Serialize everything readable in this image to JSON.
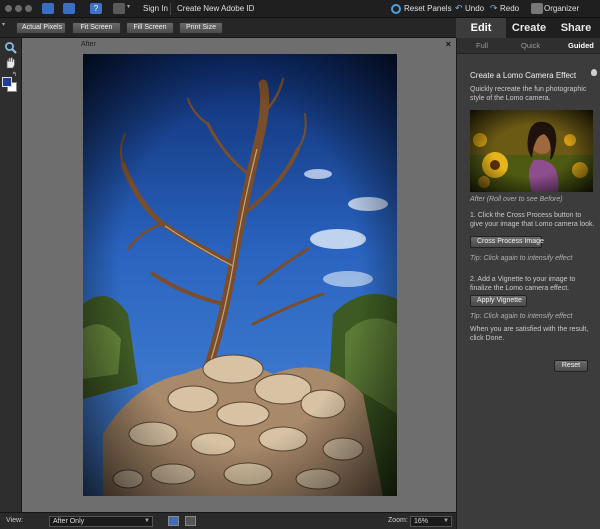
{
  "topbar": {
    "sign_in": "Sign In",
    "create_id": "Create New Adobe ID",
    "reset_panels": "Reset Panels",
    "undo": "Undo",
    "redo": "Redo",
    "organizer": "Organizer"
  },
  "mode_tabs": {
    "edit": "Edit",
    "create": "Create",
    "share": "Share"
  },
  "toolbar": {
    "actual_pixels": "Actual Pixels",
    "fit_screen": "Fit Screen",
    "fill_screen": "Fill Screen",
    "print_size": "Print Size"
  },
  "document": {
    "title": "After",
    "close": "×"
  },
  "status": {
    "view_label": "View:",
    "view_value": "After Only",
    "zoom_label": "Zoom:",
    "zoom_value": "16%"
  },
  "panel": {
    "subtabs": {
      "full": "Full",
      "quick": "Quick",
      "guided": "Guided"
    },
    "title": "Create a Lomo Camera Effect",
    "intro": "Quickly recreate the fun photographic style of the Lomo camera.",
    "caption": "After (Roll over to see Before)",
    "step1": "1. Click the Cross Process button to give your image that Lomo camera look.",
    "cross_process_btn": "Cross Process Image",
    "tip1": "Tip: Click again to intensify effect",
    "step2": "2. Add a Vignette to your image to finalize the Lomo camera effect.",
    "vignette_btn": "Apply Vignette",
    "tip2": "Tip: Click again to intensify effect",
    "done_text": "When you are satisfied with the result, click Done.",
    "reset_btn": "Reset"
  },
  "icons": {
    "zoom": "zoom-tool-icon",
    "hand": "hand-tool-icon",
    "swap": "swap-colors-icon",
    "bulb": "lightbulb-icon"
  }
}
